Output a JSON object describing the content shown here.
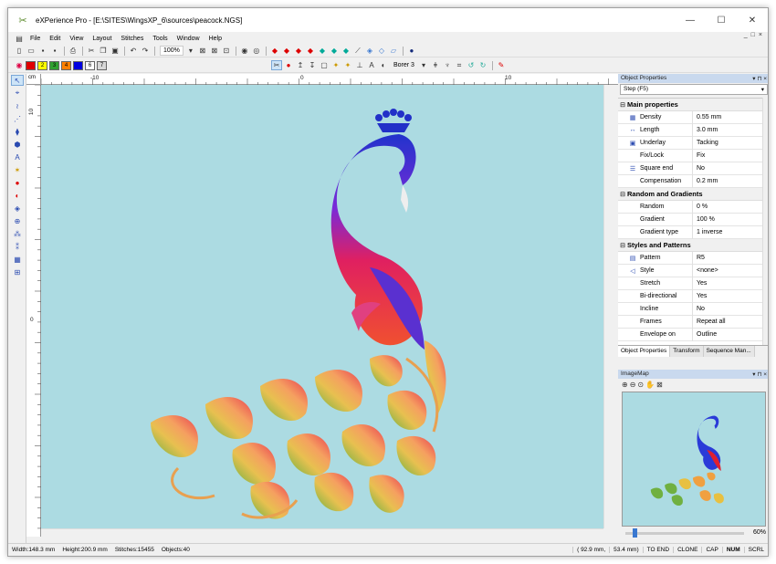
{
  "window": {
    "title": "eXPerience Pro - [E:\\SITES\\WingsXP_6\\sources\\peacock.NGS]",
    "minimize": "—",
    "maximize": "☐",
    "close": "✕"
  },
  "menu": {
    "items": [
      "File",
      "Edit",
      "View",
      "Layout",
      "Stitches",
      "Tools",
      "Window",
      "Help"
    ],
    "mdi": [
      "_",
      "□",
      "×"
    ]
  },
  "toolbar": {
    "zoom": "100%",
    "palette": [
      {
        "label": "1",
        "color": "#e00000"
      },
      {
        "label": "2",
        "color": "#ffff00"
      },
      {
        "label": "3",
        "color": "#30a030"
      },
      {
        "label": "4",
        "color": "#ff8000"
      },
      {
        "label": "5",
        "color": "#0000e0"
      },
      {
        "label": "6",
        "color": "#ffffff"
      },
      {
        "label": "7",
        "color": "#d8d8d8"
      }
    ],
    "borer": "Borer 3"
  },
  "ruler": {
    "unit": "cm",
    "top": [
      "-10",
      "0",
      "10"
    ],
    "left": [
      "10",
      "0"
    ]
  },
  "status": {
    "width": "Width:148.3 mm",
    "height": "Height:200.9 mm",
    "stitches": "Stitches:15455",
    "objects": "Objects:40",
    "coords": "( 92.9 mm,",
    "coords2": "53.4 mm)",
    "flags": [
      "TO END",
      "CLONE",
      "CAP",
      "NUM",
      "SCRL"
    ]
  },
  "props": {
    "panel_title": "Object Properties",
    "selector": "Step (F5)",
    "groups": [
      {
        "name": "Main properties",
        "rows": [
          {
            "icon": "density-icon",
            "glyph": "▦",
            "name": "Density",
            "value": "0.55 mm"
          },
          {
            "icon": "length-icon",
            "glyph": "↔",
            "name": "Length",
            "value": "3.0 mm"
          },
          {
            "icon": "underlay-icon",
            "glyph": "▣",
            "name": "Underlay",
            "value": "Tacking"
          },
          {
            "icon": "",
            "glyph": "",
            "name": "Fix/Lock",
            "value": "Fix"
          },
          {
            "icon": "square-end-icon",
            "glyph": "☰",
            "name": "Square end",
            "value": "No"
          },
          {
            "icon": "",
            "glyph": "",
            "name": "Compensation",
            "value": "0.2 mm"
          }
        ]
      },
      {
        "name": "Random and Gradients",
        "rows": [
          {
            "icon": "",
            "glyph": "",
            "name": "Random",
            "value": "0 %"
          },
          {
            "icon": "",
            "glyph": "",
            "name": "Gradient",
            "value": "100 %"
          },
          {
            "icon": "",
            "glyph": "",
            "name": "Gradient type",
            "value": "1 inverse"
          }
        ]
      },
      {
        "name": "Styles and Patterns",
        "rows": [
          {
            "icon": "pattern-icon",
            "glyph": "▤",
            "name": "Pattern",
            "value": "R5"
          },
          {
            "icon": "style-icon",
            "glyph": "◁",
            "name": "Style",
            "value": "<none>"
          },
          {
            "icon": "",
            "glyph": "",
            "name": "Stretch",
            "value": "Yes"
          },
          {
            "icon": "",
            "glyph": "",
            "name": "Bi-directional",
            "value": "Yes"
          },
          {
            "icon": "",
            "glyph": "",
            "name": "Incline",
            "value": "No"
          },
          {
            "icon": "",
            "glyph": "",
            "name": "Frames",
            "value": "Repeat all"
          },
          {
            "icon": "",
            "glyph": "",
            "name": "Envelope on",
            "value": "Outline"
          }
        ]
      }
    ],
    "tabs": [
      "Object Properties",
      "Transform",
      "Sequence Man..."
    ]
  },
  "imagemap": {
    "title": "ImageMap",
    "zoom": "60%"
  }
}
